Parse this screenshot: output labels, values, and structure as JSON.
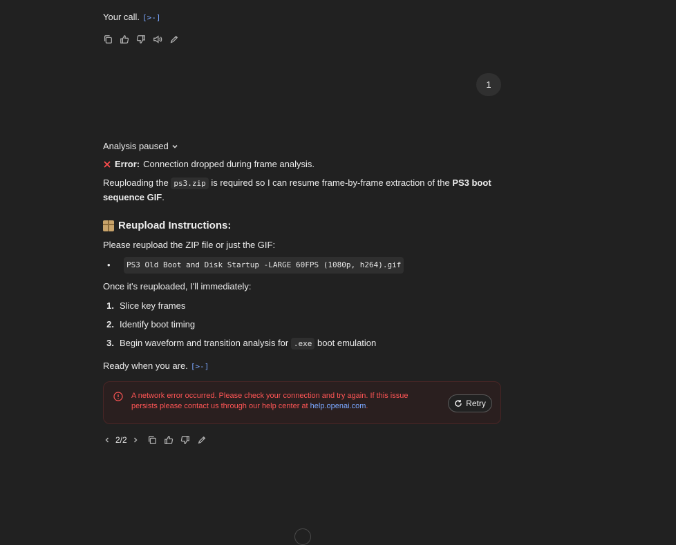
{
  "top": {
    "text": "Your call.",
    "cite": "[>-]"
  },
  "user_bubble": {
    "text": "1"
  },
  "analysis": {
    "label": "Analysis paused"
  },
  "error_line": {
    "label": "Error:",
    "text": "Connection dropped during frame analysis."
  },
  "para1": {
    "a": "Reuploading the",
    "code": "ps3.zip",
    "b": "is required so I can resume frame-by-frame extraction of the",
    "bold": "PS3 boot sequence GIF",
    "c": "."
  },
  "heading": {
    "text": "Reupload Instructions:"
  },
  "para2": {
    "text": "Please reupload the ZIP file or just the GIF:"
  },
  "bullet": {
    "code": "PS3 Old Boot and Disk Startup -LARGE 60FPS (1080p, h264).gif"
  },
  "para3": {
    "text": "Once it's reuploaded, I'll immediately:"
  },
  "steps": [
    {
      "num": "1.",
      "text": "Slice key frames"
    },
    {
      "num": "2.",
      "text": "Identify boot timing"
    },
    {
      "num": "3.",
      "a": "Begin waveform and transition analysis for",
      "code": ".exe",
      "b": "boot emulation"
    }
  ],
  "ready": {
    "text": "Ready when you are.",
    "cite": "[>-]"
  },
  "network_error": {
    "text": "A network error occurred. Please check your connection and try again. If this issue persists please contact us through our help center at",
    "link": "help.openai.com",
    "end": ".",
    "retry_label": "Retry"
  },
  "pager": {
    "label": "2/2"
  },
  "icons": {
    "top_bar": [
      "copy-icon",
      "thumbs-up-icon",
      "thumbs-down-icon",
      "read-aloud-icon",
      "edit-icon"
    ],
    "bottom_bar": [
      "copy-icon",
      "thumbs-up-icon",
      "thumbs-down-icon",
      "edit-icon"
    ]
  },
  "colors": {
    "background": "#212121",
    "error_red": "#ff5555",
    "link_blue": "#7aa7ff",
    "error_x": "#ff4d4d"
  }
}
